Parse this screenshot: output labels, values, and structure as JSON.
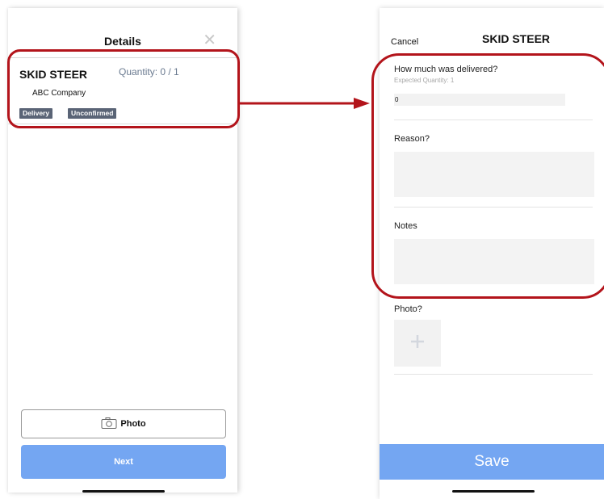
{
  "left_screen": {
    "header": {
      "title": "Details",
      "close_icon": "close-icon"
    },
    "item": {
      "name": "SKID STEER",
      "quantity": "Quantity: 0 / 1",
      "company": "ABC Company",
      "badges": [
        "Delivery",
        "Unconfirmed"
      ]
    },
    "photo_button": {
      "label": "Photo",
      "icon": "camera-icon"
    },
    "next_button": {
      "label": "Next"
    }
  },
  "right_screen": {
    "cancel_label": "Cancel",
    "title": "SKID STEER",
    "delivered": {
      "question": "How much was delivered?",
      "expected": "Expected Quantity: 1",
      "value": "0"
    },
    "reason_label": "Reason?",
    "notes_label": "Notes",
    "photo_label": "Photo?",
    "add_photo_icon": "plus-icon",
    "save_label": "Save"
  },
  "colors": {
    "accent_button": "#74a6f2",
    "badge_bg": "#5a6476",
    "highlight": "#b3141b"
  }
}
